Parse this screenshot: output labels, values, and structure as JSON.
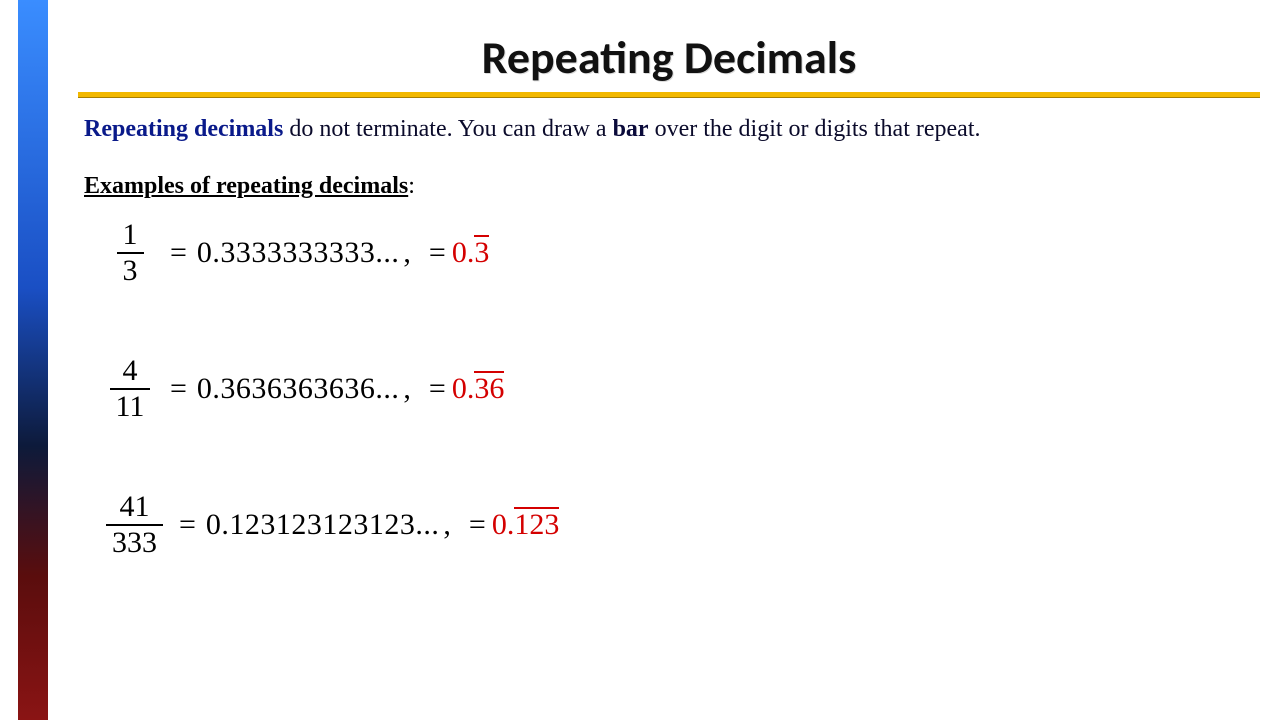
{
  "title": "Repeating Decimals",
  "intro": {
    "keyword1": "Repeating decimals",
    "mid1": " do not terminate.  You can draw a ",
    "keyword2": "bar",
    "mid2": " over the digit or digits that repeat."
  },
  "subhead": "Examples of repeating decimals",
  "examples": [
    {
      "numerator": "1",
      "denominator": "3",
      "expansion": "0.3333333333...",
      "bar_prefix": "0.",
      "bar_repeat": "3"
    },
    {
      "numerator": "4",
      "denominator": "11",
      "expansion": "0.3636363636...",
      "bar_prefix": "0.",
      "bar_repeat": "36"
    },
    {
      "numerator": "41",
      "denominator": "333",
      "expansion": "0.123123123123...",
      "bar_prefix": "0.",
      "bar_repeat": "123"
    }
  ],
  "symbols": {
    "equals": "=",
    "comma": ","
  }
}
